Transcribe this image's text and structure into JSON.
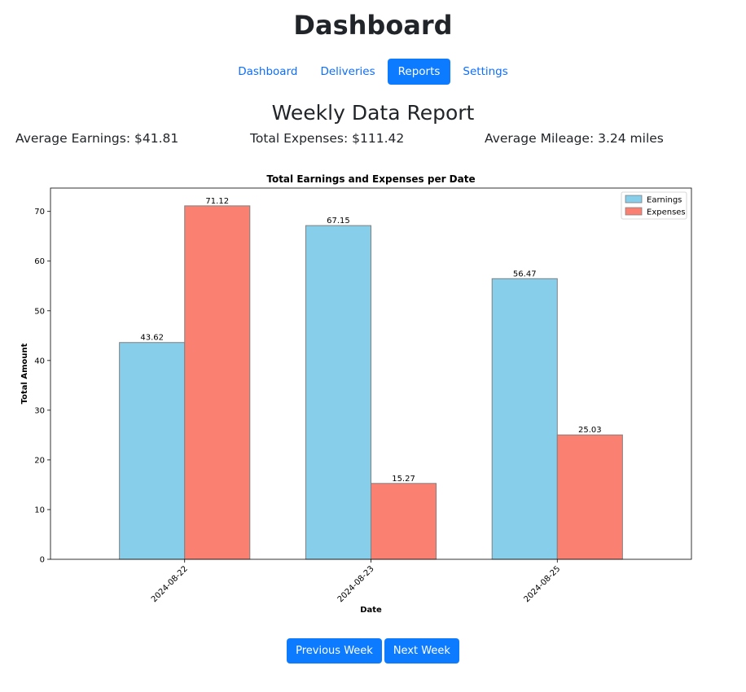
{
  "app": {
    "title": "Dashboard"
  },
  "nav": {
    "items": [
      {
        "label": "Dashboard",
        "active": false
      },
      {
        "label": "Deliveries",
        "active": false
      },
      {
        "label": "Reports",
        "active": true
      },
      {
        "label": "Settings",
        "active": false
      }
    ]
  },
  "report": {
    "title": "Weekly Data Report",
    "stats": {
      "average_earnings": "Average Earnings: $41.81",
      "total_expenses": "Total Expenses: $111.42",
      "average_mileage": "Average Mileage: 3.24 miles"
    }
  },
  "chart_data": {
    "type": "bar",
    "title": "Total Earnings and Expenses per Date",
    "xlabel": "Date",
    "ylabel": "Total Amount",
    "categories": [
      "2024-08-22",
      "2024-08-23",
      "2024-08-25"
    ],
    "series": [
      {
        "name": "Earnings",
        "values": [
          43.62,
          67.15,
          56.47
        ],
        "color": "#87ceeb"
      },
      {
        "name": "Expenses",
        "values": [
          71.12,
          15.27,
          25.03
        ],
        "color": "#fa8072"
      }
    ],
    "data_labels": [
      [
        "43.62",
        "67.15",
        "56.47"
      ],
      [
        "71.12",
        "15.27",
        "25.03"
      ]
    ],
    "ylim": [
      0,
      74.7
    ],
    "yticks": [
      0,
      10,
      20,
      30,
      40,
      50,
      60,
      70
    ],
    "grid": false,
    "legend": "top-right"
  },
  "pager": {
    "prev_label": "Previous Week",
    "next_label": "Next Week"
  },
  "colors": {
    "primary": "#0d7bff",
    "earnings": "#87ceeb",
    "expenses": "#fa8072"
  }
}
